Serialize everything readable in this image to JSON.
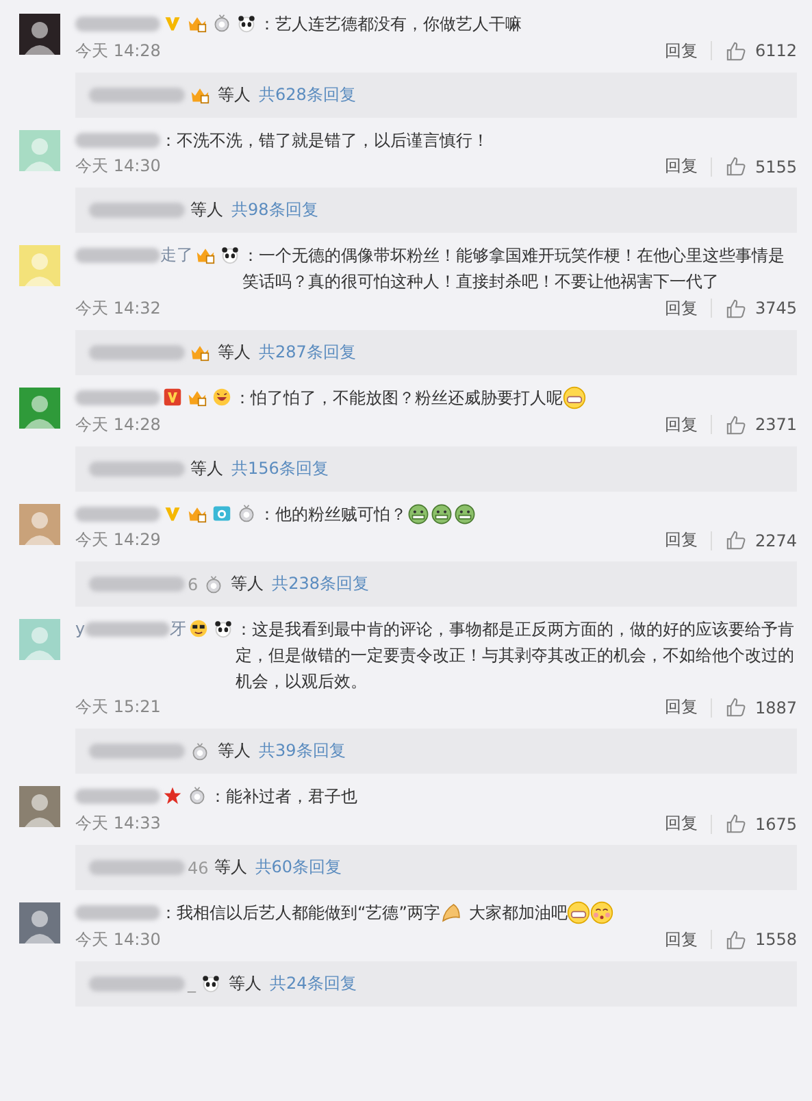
{
  "comments": [
    {
      "color": "#2a2224",
      "badges": [
        {
          "kind": "verified-gold"
        },
        {
          "kind": "crown"
        },
        {
          "kind": "medal"
        },
        {
          "kind": "panda"
        }
      ],
      "body": [
        {
          "kind": "text",
          "text": "：艺人连艺德都没有，你做艺人干嘛"
        }
      ],
      "time": "今天 14:28",
      "reply": "回复",
      "likes": "6112",
      "thread": {
        "badges": [
          {
            "kind": "crown"
          }
        ],
        "others": "等人",
        "count": "共628条回复"
      }
    },
    {
      "color": "#a8dcc4",
      "body": [
        {
          "kind": "text",
          "text": "：不洗不洗，错了就是错了，以后谨言慎行！"
        }
      ],
      "time": "今天 14:30",
      "reply": "回复",
      "likes": "5155",
      "thread": {
        "others": "等人",
        "count": "共98条回复"
      }
    },
    {
      "color": "#f3e27a",
      "name": {
        "suffix": "走了"
      },
      "badges": [
        {
          "kind": "crown"
        },
        {
          "kind": "panda"
        }
      ],
      "body": [
        {
          "kind": "text",
          "text": "：一个无德的偶像带坏粉丝！能够拿国难开玩笑作梗！在他心里这些事情是笑话吗？真的很可怕这种人！直接封杀吧！不要让他祸害下一代了"
        }
      ],
      "time": "今天 14:32",
      "reply": "回复",
      "likes": "3745",
      "thread": {
        "badges": [
          {
            "kind": "crown"
          }
        ],
        "others": "等人",
        "count": "共287条回复"
      }
    },
    {
      "color": "#2f9a3a",
      "badges": [
        {
          "kind": "verified-red"
        },
        {
          "kind": "crown"
        },
        {
          "kind": "laugh"
        }
      ],
      "body": [
        {
          "kind": "text",
          "text": "：怕了怕了，不能放图？粉丝还威胁要打人呢"
        },
        {
          "kind": "grin"
        }
      ],
      "time": "今天 14:28",
      "reply": "回复",
      "likes": "2371",
      "thread": {
        "others": "等人",
        "count": "共156条回复"
      }
    },
    {
      "color": "#c9a27a",
      "badges": [
        {
          "kind": "verified-gold"
        },
        {
          "kind": "crown"
        },
        {
          "kind": "camera"
        },
        {
          "kind": "medal"
        }
      ],
      "body": [
        {
          "kind": "text",
          "text": "：他的粉丝贼可怕？"
        },
        {
          "kind": "sick"
        },
        {
          "kind": "sick"
        },
        {
          "kind": "sick"
        }
      ],
      "time": "今天 14:29",
      "reply": "回复",
      "likes": "2274",
      "thread": {
        "name_suffix": "6",
        "badges": [
          {
            "kind": "medal"
          }
        ],
        "others": "等人",
        "count": "共238条回复"
      }
    },
    {
      "color": "#9fd6c8",
      "name": {
        "prefix": "y",
        "suffix": "牙"
      },
      "badges": [
        {
          "kind": "cool"
        },
        {
          "kind": "panda"
        }
      ],
      "body": [
        {
          "kind": "text",
          "text": "：这是我看到最中肯的评论，事物都是正反两方面的，做的好的应该要给予肯定，但是做错的一定要责令改正！与其剥夺其改正的机会，不如给他个改过的机会，以观后效。"
        }
      ],
      "time": "今天 15:21",
      "reply": "回复",
      "likes": "1887",
      "thread": {
        "badges": [
          {
            "kind": "medal"
          }
        ],
        "others": "等人",
        "count": "共39条回复"
      }
    },
    {
      "color": "#8a8070",
      "badges": [
        {
          "kind": "star"
        },
        {
          "kind": "medal"
        }
      ],
      "body": [
        {
          "kind": "text",
          "text": "：能补过者，君子也"
        }
      ],
      "time": "今天 14:33",
      "reply": "回复",
      "likes": "1675",
      "thread": {
        "name_suffix": "46",
        "others": "等人",
        "count": "共60条回复"
      }
    },
    {
      "color": "#6d7480",
      "body": [
        {
          "kind": "text",
          "text": "：我相信以后艺人都能做到“艺德”两字"
        },
        {
          "kind": "hands"
        },
        {
          "kind": "text",
          "text": " 大家都加油吧"
        },
        {
          "kind": "grin"
        },
        {
          "kind": "blush"
        }
      ],
      "time": "今天 14:30",
      "reply": "回复",
      "likes": "1558",
      "thread": {
        "name_suffix": "_",
        "badges": [
          {
            "kind": "panda"
          }
        ],
        "others": "等人",
        "count": "共24条回复"
      }
    }
  ]
}
